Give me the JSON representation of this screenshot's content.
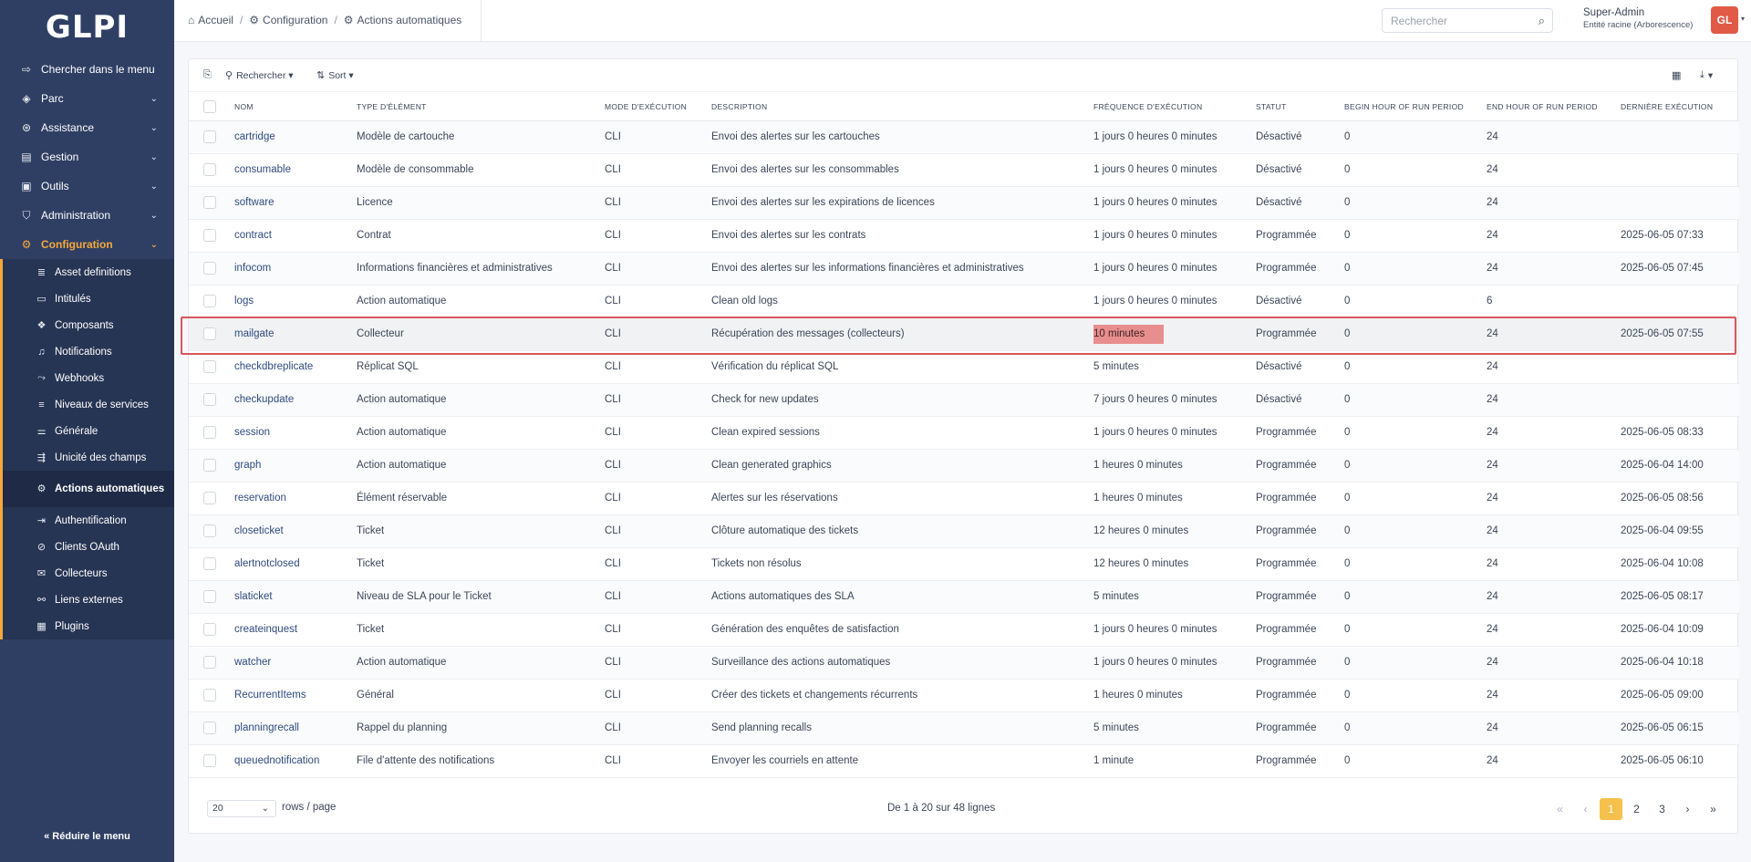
{
  "app": {
    "logo": "GLPI"
  },
  "sidebar": {
    "items": [
      {
        "label": "Chercher dans le menu",
        "icon": "arrow-right-icon",
        "chev": false
      },
      {
        "label": "Parc",
        "icon": "box-icon",
        "chev": true
      },
      {
        "label": "Assistance",
        "icon": "lifebuoy-icon",
        "chev": true
      },
      {
        "label": "Gestion",
        "icon": "wallet-icon",
        "chev": true
      },
      {
        "label": "Outils",
        "icon": "briefcase-icon",
        "chev": true
      },
      {
        "label": "Administration",
        "icon": "shield-icon",
        "chev": true
      },
      {
        "label": "Configuration",
        "icon": "gear-icon",
        "chev": true
      }
    ],
    "sub_items": [
      {
        "label": "Asset definitions"
      },
      {
        "label": "Intitulés"
      },
      {
        "label": "Composants"
      },
      {
        "label": "Notifications"
      },
      {
        "label": "Webhooks"
      },
      {
        "label": "Niveaux de services"
      },
      {
        "label": "Générale"
      },
      {
        "label": "Unicité des champs"
      },
      {
        "label": "Actions automatiques"
      },
      {
        "label": "Authentification"
      },
      {
        "label": "Clients OAuth"
      },
      {
        "label": "Collecteurs"
      },
      {
        "label": "Liens externes"
      },
      {
        "label": "Plugins"
      }
    ],
    "collapse_label": "Réduire le menu"
  },
  "header": {
    "breadcrumb": [
      "Accueil",
      "Configuration",
      "Actions automatiques"
    ],
    "search_placeholder": "Rechercher",
    "user_name": "Super-Admin",
    "user_entity": "Entité racine (Arborescence)",
    "avatar_initials": "GL"
  },
  "toolbar": {
    "search_label": "Rechercher",
    "sort_label": "Sort"
  },
  "table": {
    "columns": [
      "Nom",
      "Type d'élément",
      "Mode d'exécution",
      "Description",
      "Fréquence d'exécution",
      "Statut",
      "Begin hour of run period",
      "End hour of run period",
      "Dernière exécution"
    ],
    "rows": [
      [
        "cartridge",
        "Modèle de cartouche",
        "CLI",
        "Envoi des alertes sur les cartouches",
        "1 jours 0 heures 0 minutes",
        "Désactivé",
        "0",
        "24",
        ""
      ],
      [
        "consumable",
        "Modèle de consommable",
        "CLI",
        "Envoi des alertes sur les consommables",
        "1 jours 0 heures 0 minutes",
        "Désactivé",
        "0",
        "24",
        ""
      ],
      [
        "software",
        "Licence",
        "CLI",
        "Envoi des alertes sur les expirations de licences",
        "1 jours 0 heures 0 minutes",
        "Désactivé",
        "0",
        "24",
        ""
      ],
      [
        "contract",
        "Contrat",
        "CLI",
        "Envoi des alertes sur les contrats",
        "1 jours 0 heures 0 minutes",
        "Programmée",
        "0",
        "24",
        "2025-06-05 07:33"
      ],
      [
        "infocom",
        "Informations financières et administratives",
        "CLI",
        "Envoi des alertes sur les informations financières et administratives",
        "1 jours 0 heures 0 minutes",
        "Programmée",
        "0",
        "24",
        "2025-06-05 07:45"
      ],
      [
        "logs",
        "Action automatique",
        "CLI",
        "Clean old logs",
        "1 jours 0 heures 0 minutes",
        "Désactivé",
        "0",
        "6",
        ""
      ],
      [
        "mailgate",
        "Collecteur",
        "CLI",
        "Récupération des messages (collecteurs)",
        "10 minutes",
        "Programmée",
        "0",
        "24",
        "2025-06-05 07:55"
      ],
      [
        "checkdbreplicate",
        "Réplicat SQL",
        "CLI",
        "Vérification du réplicat SQL",
        "5 minutes",
        "Désactivé",
        "0",
        "24",
        ""
      ],
      [
        "checkupdate",
        "Action automatique",
        "CLI",
        "Check for new updates",
        "7 jours 0 heures 0 minutes",
        "Désactivé",
        "0",
        "24",
        ""
      ],
      [
        "session",
        "Action automatique",
        "CLI",
        "Clean expired sessions",
        "1 jours 0 heures 0 minutes",
        "Programmée",
        "0",
        "24",
        "2025-06-05 08:33"
      ],
      [
        "graph",
        "Action automatique",
        "CLI",
        "Clean generated graphics",
        "1 heures 0 minutes",
        "Programmée",
        "0",
        "24",
        "2025-06-04 14:00"
      ],
      [
        "reservation",
        "Élément réservable",
        "CLI",
        "Alertes sur les réservations",
        "1 heures 0 minutes",
        "Programmée",
        "0",
        "24",
        "2025-06-05 08:56"
      ],
      [
        "closeticket",
        "Ticket",
        "CLI",
        "Clôture automatique des tickets",
        "12 heures 0 minutes",
        "Programmée",
        "0",
        "24",
        "2025-06-04 09:55"
      ],
      [
        "alertnotclosed",
        "Ticket",
        "CLI",
        "Tickets non résolus",
        "12 heures 0 minutes",
        "Programmée",
        "0",
        "24",
        "2025-06-04 10:08"
      ],
      [
        "slaticket",
        "Niveau de SLA pour le Ticket",
        "CLI",
        "Actions automatiques des SLA",
        "5 minutes",
        "Programmée",
        "0",
        "24",
        "2025-06-05 08:17"
      ],
      [
        "createinquest",
        "Ticket",
        "CLI",
        "Génération des enquêtes de satisfaction",
        "1 jours 0 heures 0 minutes",
        "Programmée",
        "0",
        "24",
        "2025-06-04 10:09"
      ],
      [
        "watcher",
        "Action automatique",
        "CLI",
        "Surveillance des actions automatiques",
        "1 jours 0 heures 0 minutes",
        "Programmée",
        "0",
        "24",
        "2025-06-04 10:18"
      ],
      [
        "RecurrentItems",
        "Général",
        "CLI",
        "Créer des tickets et changements récurrents",
        "1 heures 0 minutes",
        "Programmée",
        "0",
        "24",
        "2025-06-05 09:00"
      ],
      [
        "planningrecall",
        "Rappel du planning",
        "CLI",
        "Send planning recalls",
        "5 minutes",
        "Programmée",
        "0",
        "24",
        "2025-06-05 06:15"
      ],
      [
        "queuednotification",
        "File d'attente des notifications",
        "CLI",
        "Envoyer les courriels en attente",
        "1 minute",
        "Programmée",
        "0",
        "24",
        "2025-06-05 06:10"
      ]
    ],
    "highlight_row": 6
  },
  "footer": {
    "rows_per_page": "20",
    "rows_label": "rows / page",
    "page_info": "De 1 à 20 sur 48 lignes",
    "pages": [
      "1",
      "2",
      "3"
    ],
    "current_page": "1"
  },
  "colors": {
    "sidebar": "#2f3f64",
    "accent": "#f5a83b",
    "highlight": "#d7575b"
  }
}
